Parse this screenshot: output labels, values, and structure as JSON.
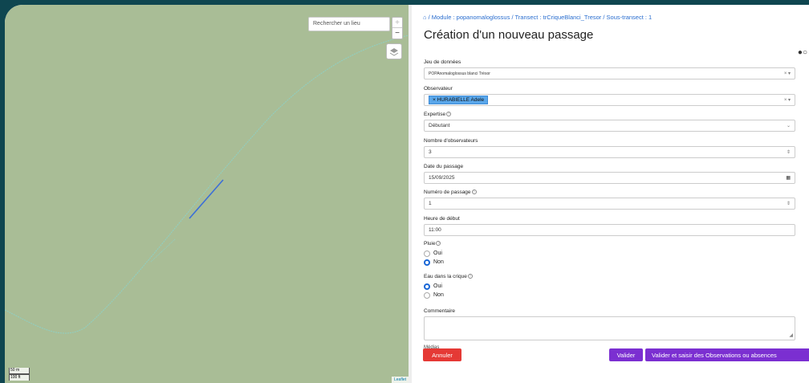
{
  "map": {
    "search_placeholder": "Rechercher un lieu",
    "zoom_in": "+",
    "zoom_out": "−",
    "layers_icon": "layers-icon",
    "scale_m": "50 m",
    "scale_ft": "100 ft",
    "attribution": "Leaflet",
    "colors": {
      "terrain": "#a9bd96",
      "transect": "#3b6fd8",
      "path": "#8fd0c4"
    }
  },
  "breadcrumb": "/ Module : popanomaloglossus / Transect : trCriqueBlanci_Tresor / Sous-transect : 1",
  "title": "Création d'un nouveau passage",
  "form": {
    "dataset": {
      "label": "Jeu de données",
      "value": "POPAnomaloglossus blanci Trésor"
    },
    "observer": {
      "label": "Observateur",
      "tag": "HURABIELLE Adele",
      "tag_remove": "×"
    },
    "expertise": {
      "label": "Expertise",
      "value": "Débutant"
    },
    "nb_observers": {
      "label": "Nombre d'observateurs",
      "value": "3"
    },
    "date": {
      "label": "Date du passage",
      "value": "15/09/2025"
    },
    "pass_number": {
      "label": "Numéro de passage",
      "value": "1"
    },
    "start_time": {
      "label": "Heure de début",
      "value": "11:00"
    },
    "rain": {
      "label": "Pluie",
      "options": [
        "Oui",
        "Non"
      ],
      "selected": "Non"
    },
    "water": {
      "label": "Eau dans la crique",
      "options": [
        "Oui",
        "Non"
      ],
      "selected": "Oui"
    },
    "comment": {
      "label": "Commentaire"
    },
    "cut_label": "Médias"
  },
  "buttons": {
    "cancel": "Annuler",
    "validate": "Valider",
    "validate_obs": "Valider et saisir des Observations ou absences"
  },
  "colors": {
    "accent": "#7b2fd1",
    "danger": "#e53935",
    "link": "#2a6ecf",
    "tag": "#5aa7ea",
    "radio": "#1a67d6"
  }
}
